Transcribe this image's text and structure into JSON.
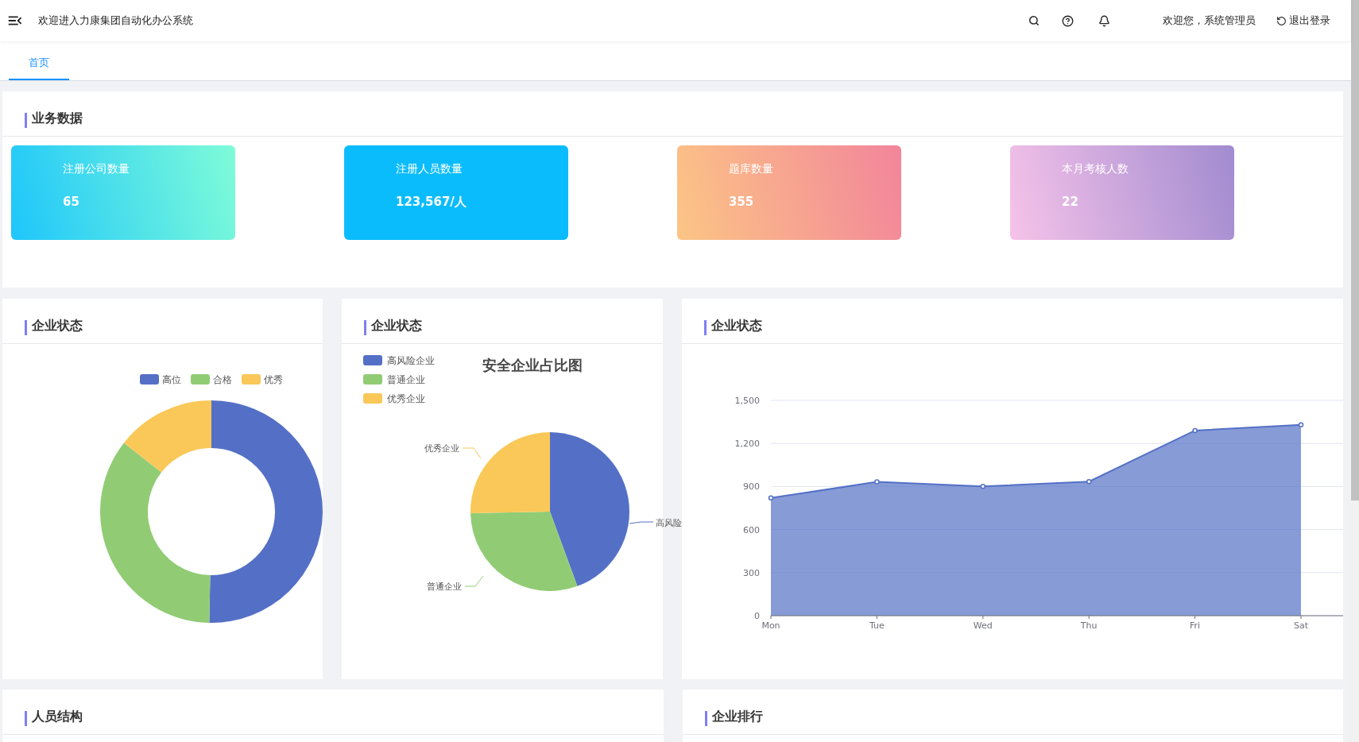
{
  "header": {
    "title": "欢迎进入力康集团自动化办公系统",
    "greeting": "欢迎您，系统管理员",
    "logout": "退出登录"
  },
  "tabs": [
    {
      "label": "首页",
      "selected": true
    }
  ],
  "business_panel": {
    "title": "业务数据",
    "cards": [
      {
        "label": "注册公司数量",
        "value": "65",
        "gradient": [
          {
            "color": "#1ec6fb"
          },
          {
            "color": "#7ffcd8"
          }
        ]
      },
      {
        "label": "注册人员数量",
        "value": "123,567/人",
        "gradient": [
          {
            "color": "#0bbcfd"
          },
          {
            "color": "#0bbcfd"
          }
        ]
      },
      {
        "label": "题库数量",
        "value": "355",
        "gradient": [
          {
            "color": "#fcc585"
          },
          {
            "color": "#f2859b"
          }
        ]
      },
      {
        "label": "本月考核人数",
        "value": "22",
        "gradient": [
          {
            "color": "#f6c3e9"
          },
          {
            "color": "#a18bd0"
          }
        ]
      }
    ]
  },
  "chart_panels": [
    {
      "title": "企业状态",
      "chart_data": {
        "type": "donut",
        "categories": [
          "高位",
          "合格",
          "优秀"
        ],
        "legend": true,
        "series": [
          {
            "values": [
              50.3,
              35.3,
              14.4
            ]
          }
        ],
        "colors": [
          "#5470c6",
          "#91cc75",
          "#fac858"
        ]
      }
    },
    {
      "title": "企业状态",
      "chart_data": {
        "type": "pie",
        "title": "安全企业占比图",
        "categories": [
          "高风险企业",
          "普通企业",
          "优秀企业"
        ],
        "legend": true,
        "series": [
          {
            "values": [
              44.4,
              30.3,
              25.3
            ]
          }
        ],
        "colors": [
          "#5470c6",
          "#91cc75",
          "#fac858"
        ],
        "annotations": [
          {
            "text": "高风险"
          },
          {
            "text": "普通企业"
          },
          {
            "text": "优秀企业"
          }
        ]
      }
    },
    {
      "title": "企业状态",
      "chart_data": {
        "type": "area",
        "categories": [
          "Mon",
          "Tue",
          "Wed",
          "Thu",
          "Fri",
          "Sat"
        ],
        "grid": true,
        "ylim": [
          0,
          1500
        ],
        "yticks": [
          0,
          {
            "value": 300,
            "label": "300"
          },
          {
            "value": 600,
            "label": "600"
          },
          {
            "value": 900,
            "label": "900"
          },
          {
            "value": 1200,
            "label": "1,200"
          },
          {
            "value": 1500,
            "label": "1,500"
          }
        ],
        "series": [
          {
            "color": "#5470c6",
            "values": [
              820,
              932,
              901,
              934,
              1290,
              1330
            ]
          }
        ]
      }
    }
  ],
  "bottom_panels": [
    {
      "title": "人员结构"
    },
    {
      "title": "企业排行"
    }
  ]
}
